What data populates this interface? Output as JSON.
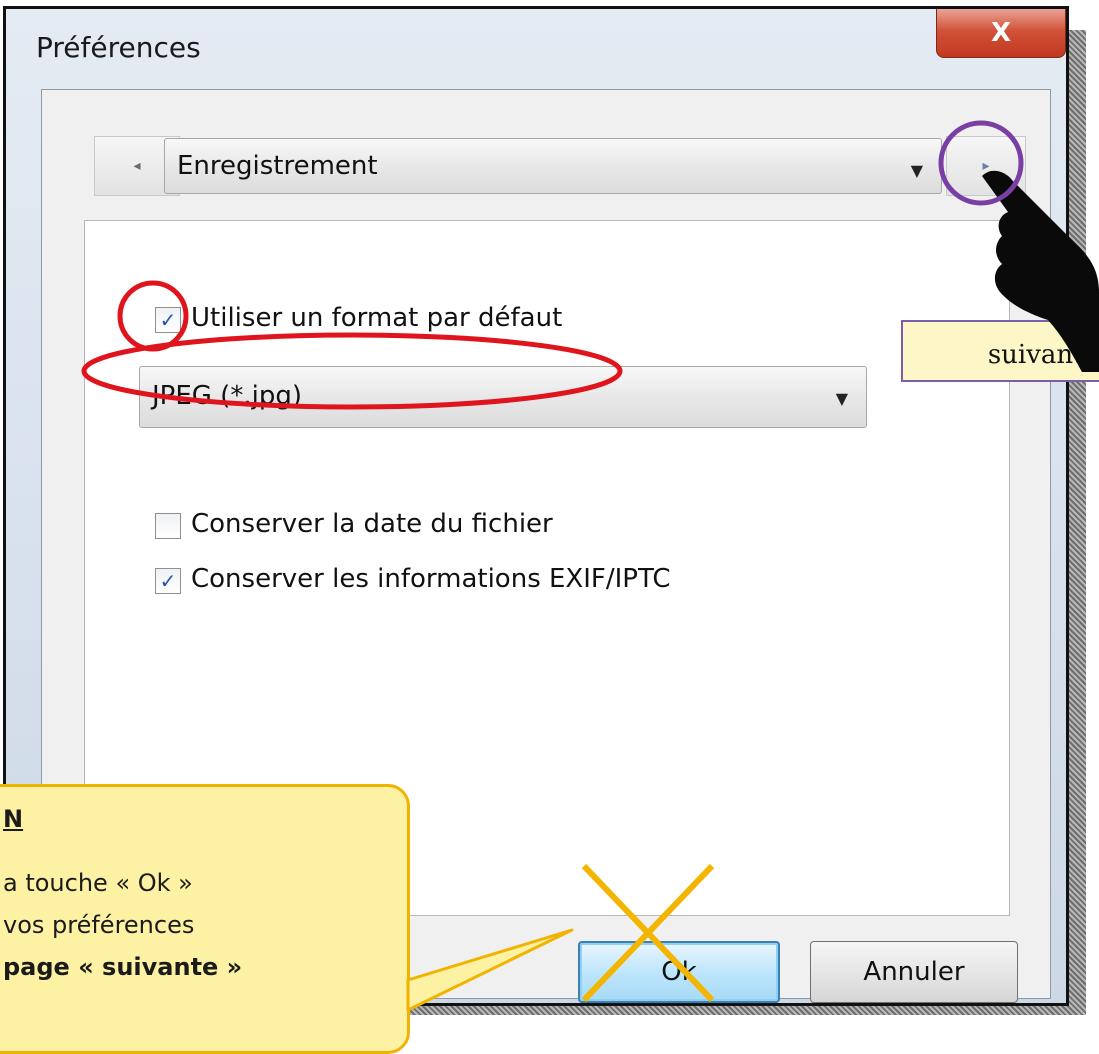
{
  "window": {
    "title": "Préférences",
    "close_glyph": "X"
  },
  "nav": {
    "prev_glyph": "◂",
    "next_glyph": "▸",
    "page_select_value": "Enregistrement",
    "dropdown_glyph": "▼"
  },
  "settings": {
    "use_default_format": {
      "label": "Utiliser un format par défaut",
      "checked": true
    },
    "format_select_value": "JPEG (*.jpg)",
    "keep_file_date": {
      "label": "Conserver la date du fichier",
      "checked": false
    },
    "keep_exif": {
      "label": "Conserver les informations EXIF/IPTC",
      "checked": true
    },
    "check_glyph": "✓"
  },
  "buttons": {
    "ok_label": "Ok",
    "cancel_label": "Annuler"
  },
  "annotations": {
    "next_tip": "suivante",
    "callout": {
      "heading": "N",
      "line1": "a touche «  Ok  »",
      "line2": "vos préférences",
      "line3": "page « suivante »"
    },
    "colors": {
      "red_circle": "#e0141c",
      "purple_circle": "#7a3fa3",
      "cross": "#f3b500",
      "callout_fill": "#fdf1a3"
    }
  }
}
